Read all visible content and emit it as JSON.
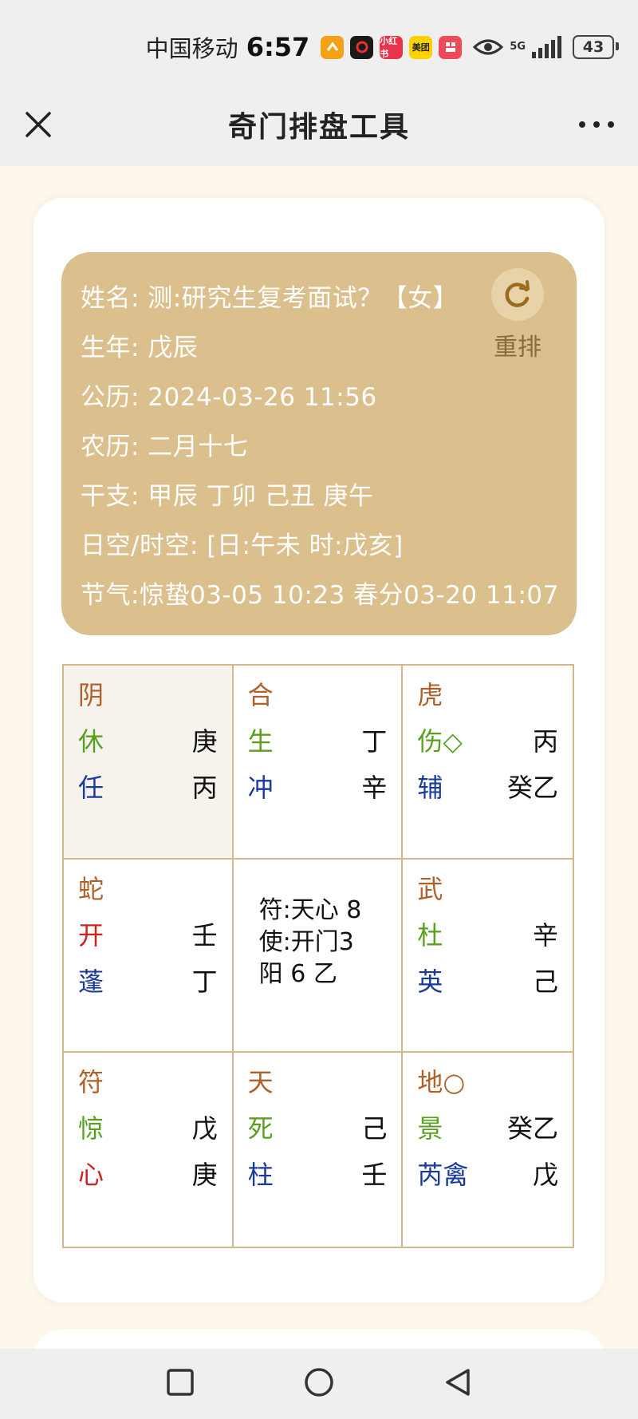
{
  "status": {
    "carrier": "中国移动",
    "time": "6:57",
    "network": "5G",
    "battery": "43",
    "apps": [
      {
        "label": "",
        "color": "#f4a118"
      },
      {
        "label": "",
        "color": "#1a1a1a"
      },
      {
        "label": "小红书",
        "color": "#e8334a"
      },
      {
        "label": "美团",
        "color": "#ffd100"
      },
      {
        "label": "",
        "color": "#ee4a5a"
      }
    ]
  },
  "nav": {
    "title": "奇门排盘工具"
  },
  "info": {
    "name": "姓名:  测:研究生复考面试？【女】",
    "birth_year": "生年:  戊辰",
    "solar": "公历:  2024-03-26 11:56",
    "lunar": "农历:  二月十七",
    "ganzhi": "干支:  甲辰 丁卯 己丑 庚午",
    "kong": "日空/时空:  [日:午未 时:戊亥]",
    "jieqi": "节气:惊蛰03-05 10:23 春分03-20 11:07",
    "rearrange_label": "重排"
  },
  "palaces": [
    {
      "god": "阴",
      "door": "休",
      "door_right": "庚",
      "star": "任",
      "star_right": "丙"
    },
    {
      "god": "合",
      "door": "生",
      "door_right": "丁",
      "star": "冲",
      "star_right": "辛"
    },
    {
      "god": "虎",
      "door": "伤◇",
      "door_right": "丙",
      "star": "辅",
      "star_right": "癸乙"
    },
    {
      "god": "蛇",
      "door": "开",
      "door_right": "壬",
      "star": "蓬",
      "star_right": "丁"
    },
    {
      "center1": "符:天心 8",
      "center2": "使:开门3",
      "center3": "阳 6 乙"
    },
    {
      "god": "武",
      "door": "杜",
      "door_right": "辛",
      "star": "英",
      "star_right": "己"
    },
    {
      "god": "符",
      "door": "惊",
      "door_right": "戊",
      "star": "心",
      "star_right": "庚"
    },
    {
      "god": "天",
      "door": "死",
      "door_right": "己",
      "star": "柱",
      "star_right": "壬"
    },
    {
      "god": "地○",
      "door": "景",
      "door_right": "癸乙",
      "star": "芮禽",
      "star_right": "戊"
    }
  ],
  "colors": {
    "info_bg": "#dbbf8d",
    "god": "#b0602a",
    "door": "#5aa020",
    "star": "#1a3a9a",
    "accent_red": "#d02020"
  }
}
